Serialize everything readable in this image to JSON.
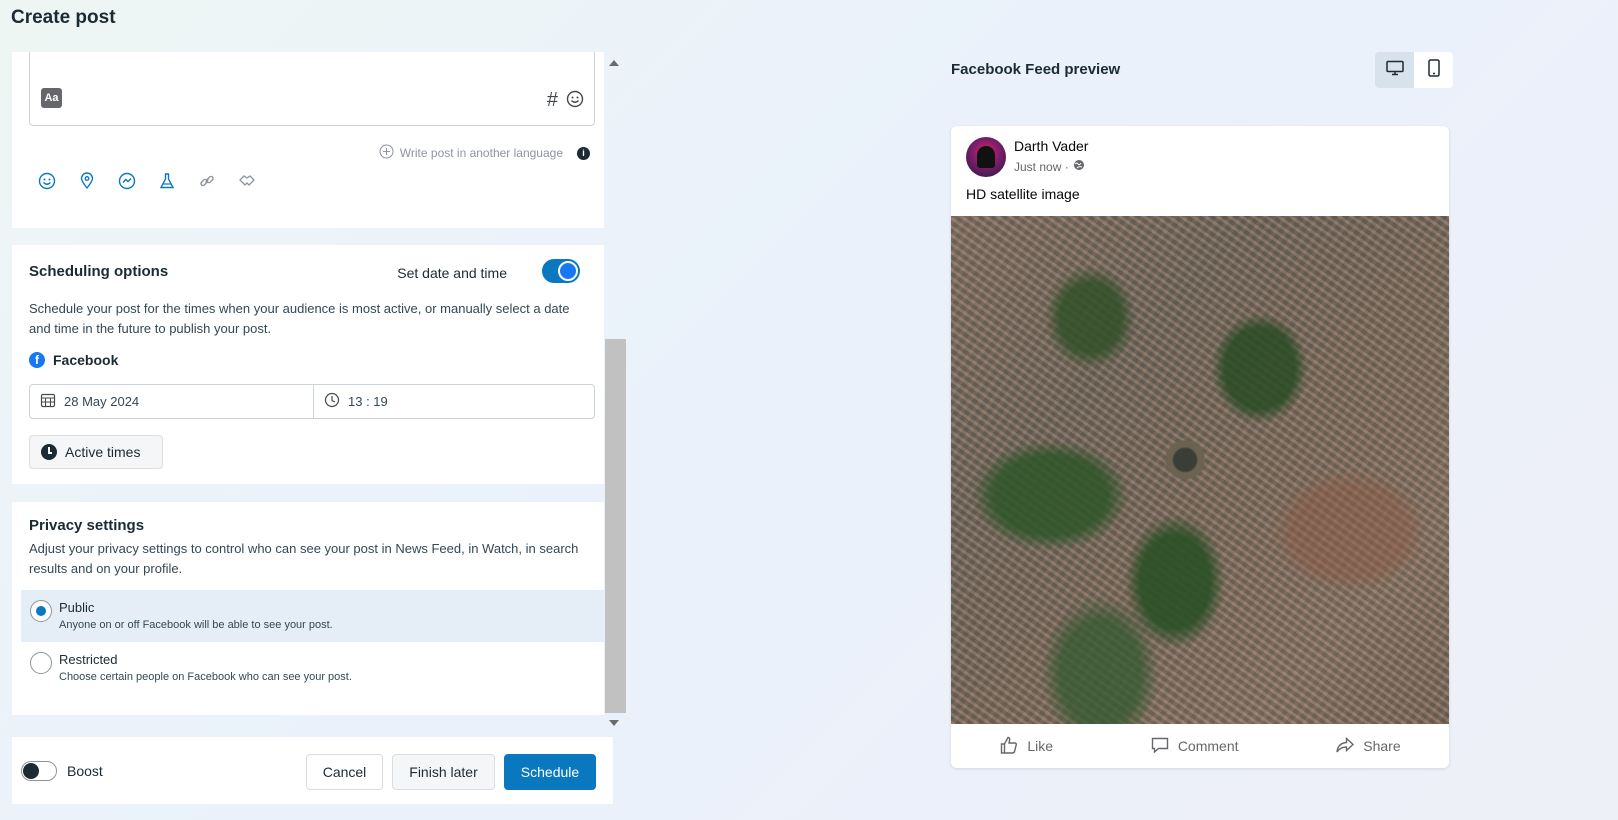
{
  "page": {
    "title": "Create post"
  },
  "compose": {
    "aa_label": "Aa",
    "hash_symbol": "#",
    "write_language": "Write post in another language",
    "info_symbol": "i",
    "tools": [
      "emoji-icon",
      "location-icon",
      "messenger-icon",
      "flask-icon",
      "link-icon",
      "handshake-icon"
    ]
  },
  "scheduling": {
    "title": "Scheduling options",
    "toggle_label": "Set date and time",
    "toggle_on": true,
    "description": "Schedule your post for the times when your audience is most active, or manually select a date and time in the future to publish your post.",
    "platform": "Facebook",
    "date": "28 May 2024",
    "time": "13 : 19",
    "active_times_label": "Active times"
  },
  "privacy": {
    "title": "Privacy settings",
    "description": "Adjust your privacy settings to control who can see your post in News Feed, in Watch, in search results and on your profile.",
    "options": [
      {
        "label": "Public",
        "sub": "Anyone on or off Facebook will be able to see your post.",
        "selected": true
      },
      {
        "label": "Restricted",
        "sub": "Choose certain people on Facebook who can see your post.",
        "selected": false
      }
    ]
  },
  "footer": {
    "boost_label": "Boost",
    "boost_on": false,
    "cancel_label": "Cancel",
    "finish_later_label": "Finish later",
    "schedule_label": "Schedule"
  },
  "preview": {
    "title": "Facebook Feed preview",
    "device_options": [
      "desktop-icon",
      "mobile-icon"
    ],
    "selected_device": "desktop",
    "post": {
      "author": "Darth Vader",
      "time": "Just now ·",
      "text": "HD satellite image",
      "actions": {
        "like": "Like",
        "comment": "Comment",
        "share": "Share"
      }
    }
  },
  "colors": {
    "accent": "#0a78be",
    "facebook": "#1877f2",
    "text": "#1c2b33"
  }
}
